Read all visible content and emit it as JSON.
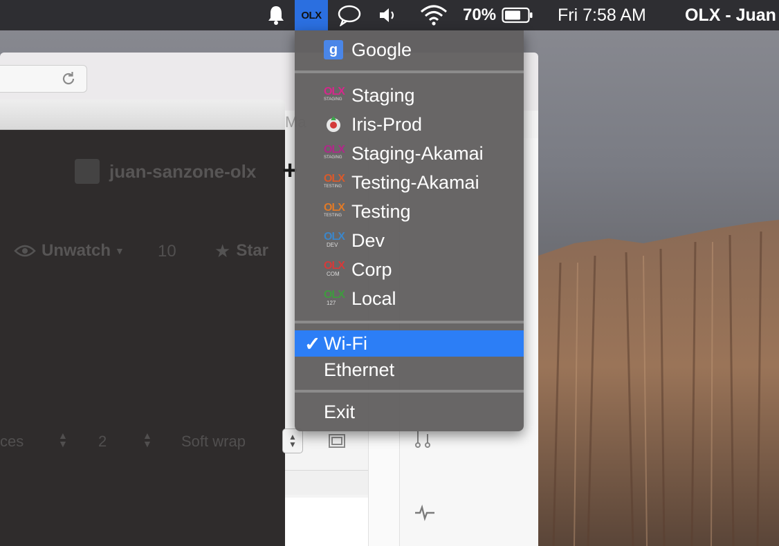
{
  "menubar": {
    "battery_percent": "70%",
    "clock": "Fri 7:58 AM",
    "app_title": "OLX - Juan",
    "olx_tile_text": "OLX",
    "accent": "#2b6fe0"
  },
  "background_app": {
    "repo_name": "juan-sanzone-olx",
    "unwatch_label": "Unwatch",
    "watch_count": "10",
    "star_label": "Star",
    "tab_fragment": "Ma",
    "editor_indent_label": "ces",
    "editor_indent_size": "2",
    "editor_wrap_label": "Soft wrap"
  },
  "menu": {
    "google_label": "Google",
    "environments": [
      {
        "label": "Staging",
        "icon": "olx-staging-icon",
        "sub": "STAGING",
        "color": "#d6278c"
      },
      {
        "label": "Iris-Prod",
        "icon": "iris-prod-icon"
      },
      {
        "label": "Staging-Akamai",
        "icon": "olx-staging-akamai-icon",
        "sub": "STAGING AKAMAI",
        "color": "#b0288a"
      },
      {
        "label": "Testing-Akamai",
        "icon": "olx-testing-akamai-icon",
        "sub": "TESTING AKAMAI",
        "color": "#d95a2b"
      },
      {
        "label": "Testing",
        "icon": "olx-testing-icon",
        "sub": "TESTING",
        "color": "#e07a28"
      },
      {
        "label": "Dev",
        "icon": "olx-dev-icon",
        "sub": "DEV",
        "color": "#3c86c9"
      },
      {
        "label": "Corp",
        "icon": "olx-corp-icon",
        "sub": "COM",
        "color": "#d63a3a"
      },
      {
        "label": "Local",
        "icon": "olx-local-icon",
        "sub": "127",
        "color": "#3f9b3f"
      }
    ],
    "networks": [
      {
        "label": "Wi-Fi",
        "checked": true
      },
      {
        "label": "Ethernet",
        "checked": false
      }
    ],
    "exit_label": "Exit",
    "selection_color": "#2c7ef6"
  }
}
